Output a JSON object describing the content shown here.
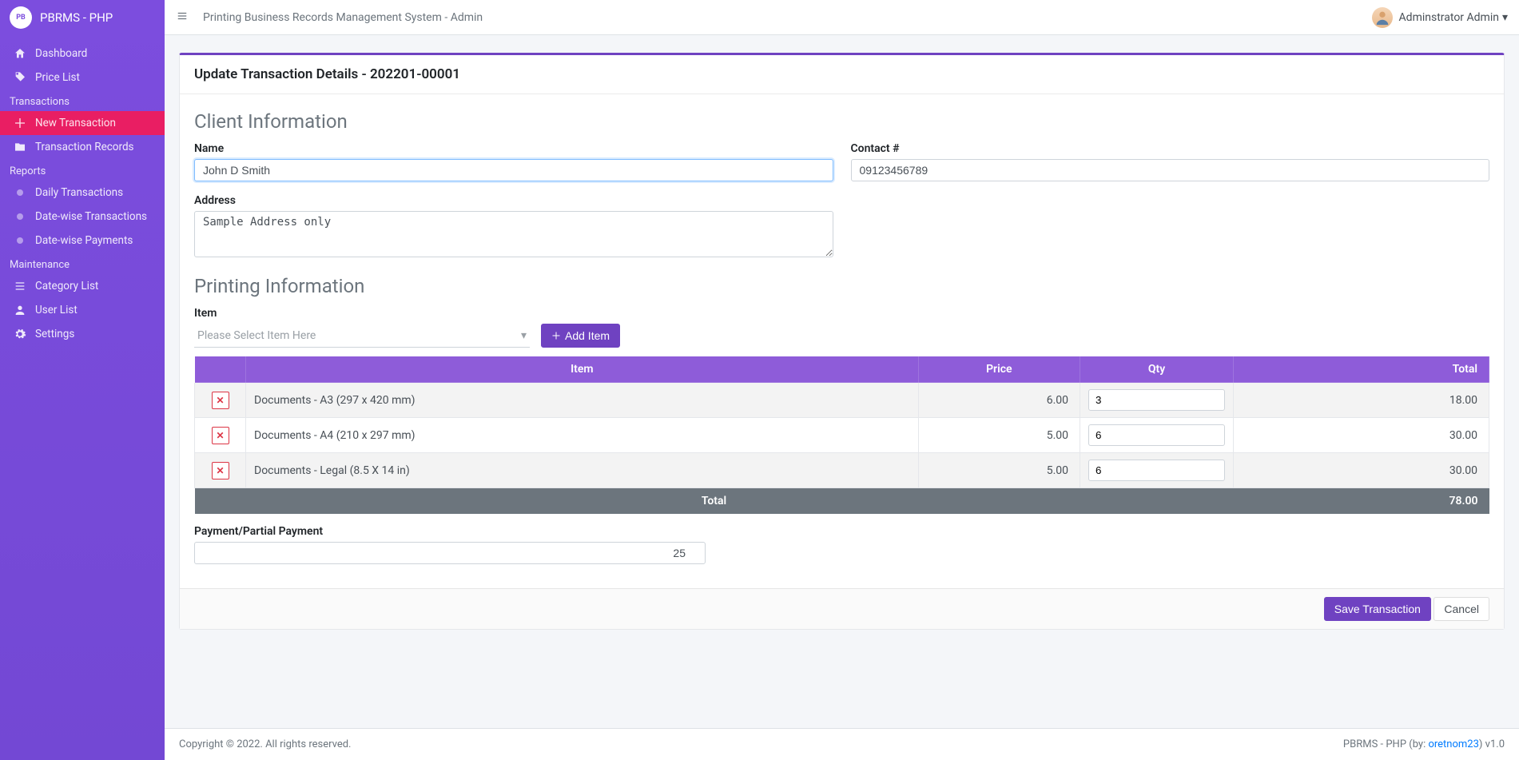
{
  "brand": {
    "text": "PBRMS - PHP",
    "logo": "PB"
  },
  "sidebar": {
    "items": [
      {
        "label": "Dashboard"
      },
      {
        "label": "Price List"
      }
    ],
    "section_transactions": "Transactions",
    "transactions": [
      {
        "label": "New Transaction"
      },
      {
        "label": "Transaction Records"
      }
    ],
    "section_reports": "Reports",
    "reports": [
      {
        "label": "Daily Transactions"
      },
      {
        "label": "Date-wise Transactions"
      },
      {
        "label": "Date-wise Payments"
      }
    ],
    "section_maintenance": "Maintenance",
    "maintenance": [
      {
        "label": "Category List"
      },
      {
        "label": "User List"
      },
      {
        "label": "Settings"
      }
    ]
  },
  "topbar": {
    "title": "Printing Business Records Management System - Admin",
    "user": "Adminstrator Admin"
  },
  "card": {
    "title": "Update Transaction Details - 202201-00001",
    "section_client": "Client Information",
    "section_printing": "Printing Information",
    "labels": {
      "name": "Name",
      "contact": "Contact #",
      "address": "Address",
      "item": "Item",
      "payment": "Payment/Partial Payment"
    },
    "values": {
      "name": "John D Smith",
      "contact": "09123456789",
      "address": "Sample Address only",
      "payment": "25"
    },
    "select_placeholder": "Please Select Item Here",
    "add_item_btn": "Add Item",
    "table": {
      "headers": {
        "item": "Item",
        "price": "Price",
        "qty": "Qty",
        "total": "Total"
      },
      "rows": [
        {
          "item": "Documents - A3 (297 x 420 mm)",
          "price": "6.00",
          "qty": "3",
          "total": "18.00"
        },
        {
          "item": "Documents - A4 (210 x 297 mm)",
          "price": "5.00",
          "qty": "6",
          "total": "30.00"
        },
        {
          "item": "Documents - Legal (8.5 X 14 in)",
          "price": "5.00",
          "qty": "6",
          "total": "30.00"
        }
      ],
      "footer_label": "Total",
      "footer_total": "78.00"
    },
    "buttons": {
      "save": "Save Transaction",
      "cancel": "Cancel"
    }
  },
  "footer": {
    "left": "Copyright © 2022. All rights reserved.",
    "right_prefix": "PBRMS - PHP (by: ",
    "right_link": "oretnom23",
    "right_suffix": ") v1.0"
  }
}
